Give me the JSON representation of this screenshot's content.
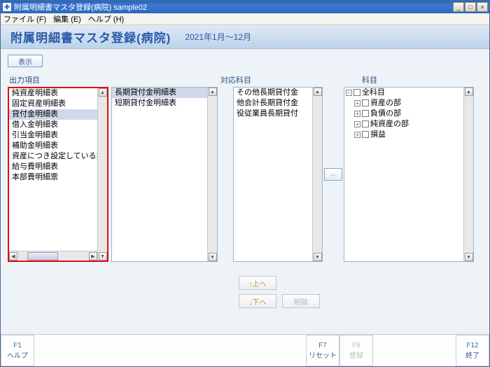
{
  "window": {
    "title": "附属明細書マスタ登録(病院) sample02",
    "icon_text": "✚",
    "controls": {
      "min": "_",
      "max": "□",
      "close": "×"
    }
  },
  "menubar": {
    "file": "ファイル (F)",
    "edit": "編集 (E)",
    "help": "ヘルプ (H)"
  },
  "banner": {
    "heading": "附属明細書マスタ登録(病院)",
    "period": "2021年1月～12月"
  },
  "toolbar": {
    "display_label": "表示"
  },
  "sections": {
    "output": "出力項目",
    "target": "対応科目",
    "account": "科目"
  },
  "lists": {
    "output": {
      "selected_index": 2,
      "items": [
        "純資産明細表",
        "固定資産明細表",
        "貸付金明細表",
        "借入金明細表",
        "引当金明細表",
        "補助金明細表",
        "資産につき設定している担保権",
        "給与費明細表",
        "本部費明細票"
      ]
    },
    "detail": {
      "selected_index": 0,
      "items": [
        "長期貸付金明細表",
        "短期貸付金明細表"
      ]
    },
    "target": {
      "items": [
        "その他長期貸付金",
        "他会計長期貸付金",
        "役従業員長期貸付"
      ]
    },
    "tree": {
      "root": "全科目",
      "root_expand": "−",
      "child_expand": "+",
      "children": [
        "資産の部",
        "負債の部",
        "純資産の部",
        "損益"
      ]
    }
  },
  "transfer": {
    "left_arrow": "←"
  },
  "order_buttons": {
    "up": "↑上へ",
    "down": "↓下へ",
    "delete": "削除"
  },
  "fkeys": {
    "f1": {
      "k": "F1",
      "t": "ヘルプ"
    },
    "f7": {
      "k": "F7",
      "t": "リセット"
    },
    "f8": {
      "k": "F8",
      "t": "登録"
    },
    "f12": {
      "k": "F12",
      "t": "終了"
    }
  },
  "scroll": {
    "up": "▲",
    "down": "▼",
    "left": "◀",
    "right": "▶"
  }
}
